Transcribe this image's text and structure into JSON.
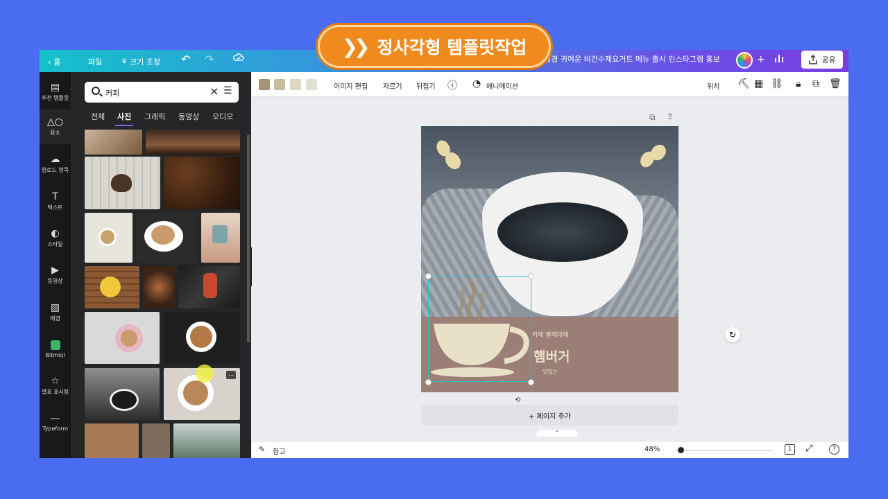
{
  "banner": {
    "text": "정사각형 템플릿작업",
    "chevron_icon": "double-chevron-right-icon"
  },
  "topbar": {
    "home": "홈",
    "file": "파일",
    "resize": "크기 조정",
    "doc_title": "배경 귀여운 비건수제요거트 메뉴 출시 인스타그램 홍보",
    "add": "+",
    "share": "공유"
  },
  "rail": {
    "items": [
      {
        "label": "추천 템플릿",
        "icon": "template-icon"
      },
      {
        "label": "요소",
        "icon": "elements-icon"
      },
      {
        "label": "업로드 항목",
        "icon": "upload-icon"
      },
      {
        "label": "텍스트",
        "icon": "text-icon"
      },
      {
        "label": "스타일",
        "icon": "style-icon"
      },
      {
        "label": "동영상",
        "icon": "video-icon"
      },
      {
        "label": "배경",
        "icon": "background-icon"
      },
      {
        "label": "Bitmoji",
        "icon": "bitmoji-icon"
      },
      {
        "label": "별표 표시됨",
        "icon": "star-icon"
      },
      {
        "label": "Typeform",
        "icon": "typeform-icon"
      }
    ]
  },
  "panel": {
    "search_value": "커피",
    "tabs": [
      "전체",
      "사진",
      "그래픽",
      "동영상",
      "오디오"
    ]
  },
  "toolbar": {
    "swatches": [
      "#a69276",
      "#c8bc9b",
      "#ddd6c0",
      "#e2e0d5"
    ],
    "edit_image": "이미지 편집",
    "crop": "자르기",
    "flip": "뒤집기",
    "animate": "애니메이션",
    "position": "위치"
  },
  "design": {
    "subtitle": "카페 별헤데레",
    "title": "햄버거",
    "tagline": "맛있는",
    "brown": "#9b7f77",
    "cream": "#e9dfc8"
  },
  "canvas": {
    "add_page": "+ 페이지 추가"
  },
  "statusbar": {
    "notes": "참고",
    "zoom": "48%",
    "page_count": "1",
    "help": "?"
  }
}
